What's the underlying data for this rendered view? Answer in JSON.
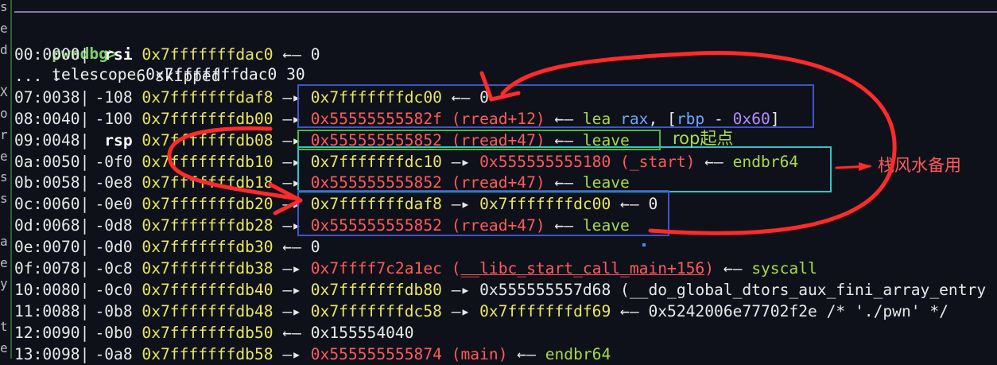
{
  "gutter_chars": [
    "s",
    "e",
    "d",
    "",
    "X",
    "o",
    "r",
    "e",
    "s",
    "s",
    "",
    "a",
    "e",
    "y",
    "",
    "t",
    "e"
  ],
  "prompt": "pwndbg>",
  "command": "telescope 0x7fffffffdac0 30",
  "rows": [
    {
      "idx": "00:0000",
      "reg": "rsi",
      "addr": "0x7fffffffdac0",
      "tail": [
        {
          "c": "arrow",
          "t": " ←— "
        },
        {
          "c": "plain",
          "t": "0"
        }
      ]
    },
    {
      "skip": "... ↓        6 skipped"
    },
    {
      "idx": "07:0038",
      "reg": "-108",
      "addr": "0x7fffffffdaf8",
      "tail": [
        {
          "c": "arrow",
          "t": " —▸ "
        },
        {
          "c": "stk",
          "t": "0x7fffffffdc00"
        },
        {
          "c": "arrow",
          "t": " ←— "
        },
        {
          "c": "plain",
          "t": "0"
        }
      ]
    },
    {
      "idx": "08:0040",
      "reg": "-100",
      "addr": "0x7fffffffdb00",
      "tail": [
        {
          "c": "arrow",
          "t": " —▸ "
        },
        {
          "c": "code",
          "t": "0x55555555582f (rread+12)"
        },
        {
          "c": "arrow",
          "t": " ←— "
        },
        {
          "c": "ins",
          "t": "lea "
        },
        {
          "c": "insreg",
          "t": "rax"
        },
        {
          "c": "plain",
          "t": ", ["
        },
        {
          "c": "insreg",
          "t": "rbp"
        },
        {
          "c": "plain",
          "t": " - "
        },
        {
          "c": "num",
          "t": "0x60"
        },
        {
          "c": "plain",
          "t": "]"
        }
      ]
    },
    {
      "idx": "09:0048",
      "reg": "rsp",
      "addr": "0x7fffffffdb08",
      "bold": true,
      "tail": [
        {
          "c": "arrow",
          "t": " —▸ "
        },
        {
          "c": "code",
          "t": "0x555555555852 (rread+47)"
        },
        {
          "c": "arrow",
          "t": " ←— "
        },
        {
          "c": "ins",
          "t": "leave"
        }
      ]
    },
    {
      "idx": "0a:0050",
      "reg": "-0f0",
      "addr": "0x7fffffffdb10",
      "tail": [
        {
          "c": "arrow",
          "t": " —▸ "
        },
        {
          "c": "stk",
          "t": "0x7fffffffdc10"
        },
        {
          "c": "arrow",
          "t": " —▸ "
        },
        {
          "c": "code",
          "t": "0x555555555180 (_start)"
        },
        {
          "c": "arrow",
          "t": " ←— "
        },
        {
          "c": "ins",
          "t": "endbr64"
        }
      ]
    },
    {
      "idx": "0b:0058",
      "reg": "-0e8",
      "addr": "0x7fffffffdb18",
      "tail": [
        {
          "c": "arrow",
          "t": " —▸ "
        },
        {
          "c": "code",
          "t": "0x555555555852 (rread+47)"
        },
        {
          "c": "arrow",
          "t": " ←— "
        },
        {
          "c": "ins",
          "t": "leave"
        }
      ]
    },
    {
      "idx": "0c:0060",
      "reg": "-0e0",
      "addr": "0x7fffffffdb20",
      "tail": [
        {
          "c": "arrow",
          "t": " —▸ "
        },
        {
          "c": "stk",
          "t": "0x7fffffffdaf8"
        },
        {
          "c": "arrow",
          "t": " —▸ "
        },
        {
          "c": "stk",
          "t": "0x7fffffffdc00"
        },
        {
          "c": "arrow",
          "t": " ←— "
        },
        {
          "c": "plain",
          "t": "0"
        }
      ]
    },
    {
      "idx": "0d:0068",
      "reg": "-0d8",
      "addr": "0x7fffffffdb28",
      "tail": [
        {
          "c": "arrow",
          "t": " —▸ "
        },
        {
          "c": "code",
          "t": "0x555555555852 (rread+47)"
        },
        {
          "c": "arrow",
          "t": " ←— "
        },
        {
          "c": "ins",
          "t": "leave"
        }
      ]
    },
    {
      "idx": "0e:0070",
      "reg": "-0d0",
      "addr": "0x7fffffffdb30",
      "tail": [
        {
          "c": "arrow",
          "t": " ←— "
        },
        {
          "c": "plain",
          "t": "0"
        }
      ]
    },
    {
      "idx": "0f:0078",
      "reg": "-0c8",
      "addr": "0x7fffffffdb38",
      "tail": [
        {
          "c": "arrow",
          "t": " —▸ "
        },
        {
          "c": "code",
          "t": "0x7ffff7c2a1ec ("
        },
        {
          "c": "code u",
          "t": "__libc_start_call_main+156"
        },
        {
          "c": "code",
          "t": ")"
        },
        {
          "c": "arrow",
          "t": " ←— "
        },
        {
          "c": "ins",
          "t": "syscall"
        }
      ]
    },
    {
      "idx": "10:0080",
      "reg": "-0c0",
      "addr": "0x7fffffffdb40",
      "tail": [
        {
          "c": "arrow",
          "t": " —▸ "
        },
        {
          "c": "stk",
          "t": "0x7fffffffdb80"
        },
        {
          "c": "arrow",
          "t": " —▸ "
        },
        {
          "c": "plain",
          "t": "0x555555557d68 (__do_global_dtors_aux_fini_array_entry"
        }
      ]
    },
    {
      "idx": "11:0088",
      "reg": "-0b8",
      "addr": "0x7fffffffdb48",
      "tail": [
        {
          "c": "arrow",
          "t": " —▸ "
        },
        {
          "c": "stk",
          "t": "0x7fffffffdc58"
        },
        {
          "c": "arrow",
          "t": " —▸ "
        },
        {
          "c": "stk",
          "t": "0x7fffffffdf69"
        },
        {
          "c": "arrow",
          "t": " ←— "
        },
        {
          "c": "plain",
          "t": "0x5242006e77702f2e /* './pwn' */"
        }
      ]
    },
    {
      "idx": "12:0090",
      "reg": "-0b0",
      "addr": "0x7fffffffdb50",
      "tail": [
        {
          "c": "arrow",
          "t": " ←— "
        },
        {
          "c": "plain",
          "t": "0x155554040"
        }
      ]
    },
    {
      "idx": "13:0098",
      "reg": "-0a8",
      "addr": "0x7fffffffdb58",
      "tail": [
        {
          "c": "arrow",
          "t": " —▸ "
        },
        {
          "c": "code",
          "t": "0x555555555874 (main)"
        },
        {
          "c": "arrow",
          "t": " ←— "
        },
        {
          "c": "ins",
          "t": "endbr64"
        }
      ]
    }
  ],
  "annotations": {
    "rop_start": "rop起点",
    "fengshui": "栈风水备用"
  },
  "colors": {
    "background": "#0f111a",
    "prompt": "#7cd06b",
    "stack_addr": "#e8e663",
    "code_addr": "#ff5a5a",
    "instruction": "#a5d94e",
    "register_operand": "#6aa9ff",
    "immediate": "#b48cff",
    "box_blue": "#3d55c7",
    "box_green": "#4ab83a",
    "box_cyan": "#2ec6c6",
    "hand_drawn_red": "#ff2a2a"
  },
  "icons": [
    "down-arrow-glyph",
    "pointer-arrow-glyph",
    "deref-arrow-glyph"
  ]
}
